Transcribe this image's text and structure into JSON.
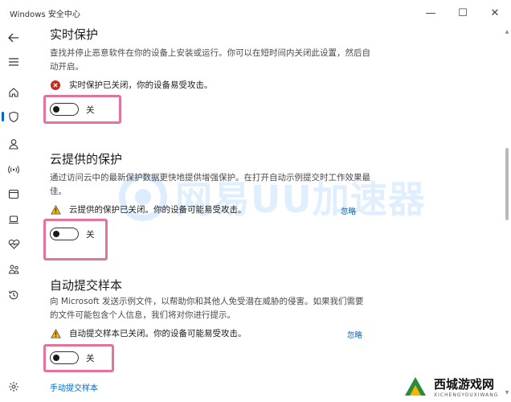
{
  "window": {
    "title": "Windows 安全中心",
    "controls": {
      "minimize": "—",
      "maximize": "☐",
      "close": "✕"
    }
  },
  "sidebar": {
    "items": [
      {
        "icon": "back-arrow-icon"
      },
      {
        "icon": "hamburger-menu-icon"
      },
      {
        "icon": "home-icon"
      },
      {
        "icon": "shield-icon",
        "active": true
      },
      {
        "icon": "person-icon"
      },
      {
        "icon": "wifi-signal-icon"
      },
      {
        "icon": "app-browser-icon"
      },
      {
        "icon": "device-laptop-icon"
      },
      {
        "icon": "heart-pulse-icon"
      },
      {
        "icon": "family-icon"
      },
      {
        "icon": "history-icon"
      },
      {
        "icon": "settings-gear-icon"
      }
    ]
  },
  "sections": {
    "realtime": {
      "title": "实时保护",
      "description": "查找并停止恶意软件在你的设备上安装或运行。你可以在短时间内关闭此设置，然后自动开启。",
      "status_text": "实时保护已关闭，你的设备易受攻击。",
      "status_icon": "error-x-icon",
      "toggle_label": "关"
    },
    "cloud": {
      "title": "云提供的保护",
      "description": "通过访问云中的最新保护数据更快地提供增强保护。在打开自动示例提交时工作效果最佳。",
      "status_text": "云提供的保护已关闭。你的设备可能易受攻击。",
      "status_icon": "warning-triangle-icon",
      "dismiss_label": "忽略",
      "toggle_label": "关"
    },
    "sample": {
      "title": "自动提交样本",
      "description": "向 Microsoft 发送示例文件，以帮助你和其他人免受潜在威胁的侵害。如果我们需要的文件可能包含个人信息，我们将对你进行提示。",
      "status_text": "自动提交样本已关闭。你的设备可能易受攻击。",
      "status_icon": "warning-triangle-icon",
      "dismiss_label": "忽略",
      "toggle_label": "关",
      "link_label": "手动提交样本"
    }
  },
  "watermark": {
    "text": "网易UU加速器"
  },
  "badge": {
    "title": "西城游戏网",
    "subtitle": "XICHENGYOUXIWANG"
  },
  "colors": {
    "accent": "#0067c0",
    "highlight_box": "#e0749c",
    "error": "#c42b1c",
    "warning": "#f2b600"
  }
}
